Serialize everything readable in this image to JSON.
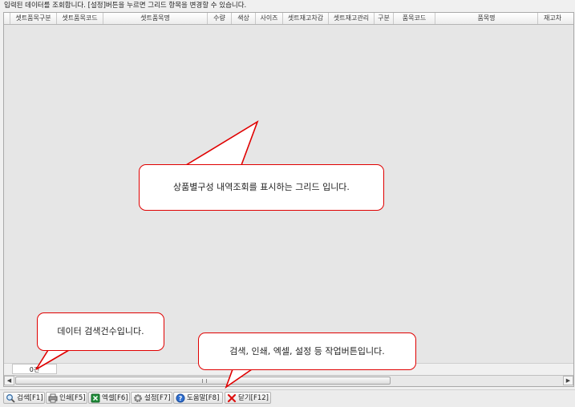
{
  "info_bar": {
    "text": "입력된 데이터를 조회합니다. [설정]버튼을 누르면 그리드 항목을 변경할 수 있습니다."
  },
  "grid": {
    "columns": [
      "셋트품목구분",
      "셋트품목코드",
      "셋트품목명",
      "수량",
      "색상",
      "사이즈",
      "셋트재고차감",
      "셋트재고관리",
      "구분",
      "품목코드",
      "품목명",
      "재고차"
    ],
    "count_text": "0건"
  },
  "toolbar": {
    "buttons": [
      {
        "label": "검색[F1]",
        "icon": "search-icon"
      },
      {
        "label": "인쇄[F5]",
        "icon": "printer-icon"
      },
      {
        "label": "엑셀[F6]",
        "icon": "excel-icon"
      },
      {
        "label": "설정[F7]",
        "icon": "gear-icon"
      },
      {
        "label": "도움말[F8]",
        "icon": "help-icon"
      },
      {
        "label": "닫기[F12]",
        "icon": "close-icon"
      }
    ]
  },
  "callouts": {
    "grid": "상품별구성 내역조회를 표시하는 그리드 입니다.",
    "count": "데이터 검색건수입니다.",
    "toolbar": "검색, 인쇄, 엑셀, 설정 등 작업버튼입니다."
  },
  "colors": {
    "callout_border": "#e00000",
    "grid_background": "#e6e6e6"
  }
}
